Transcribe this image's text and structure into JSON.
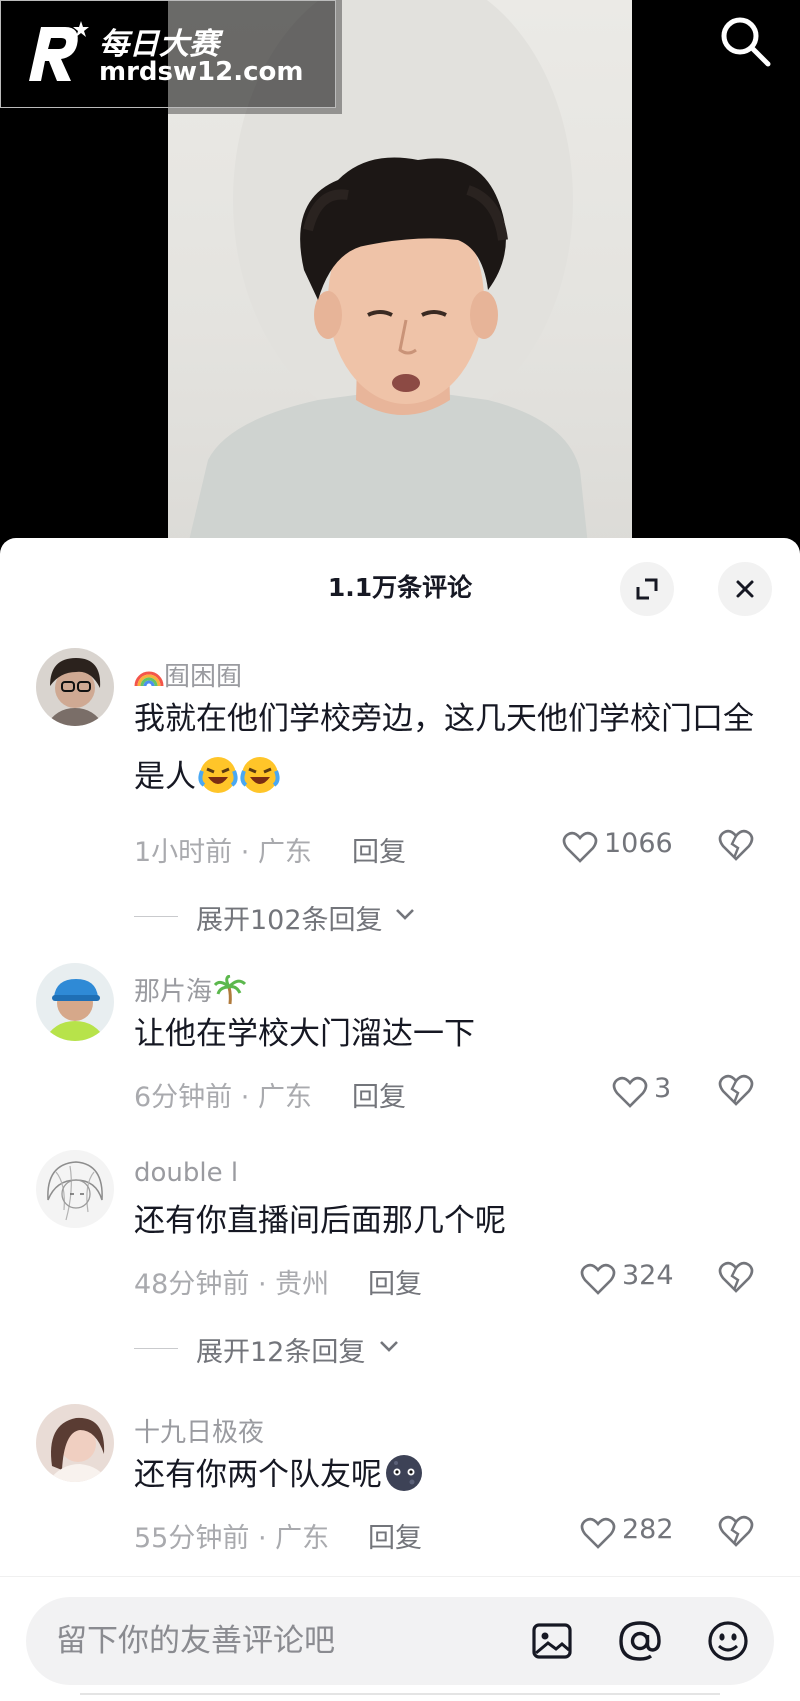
{
  "watermark": {
    "name": "每日大赛",
    "url": "mrdsw12.com"
  },
  "comments_panel": {
    "title": "1.1万条评论",
    "comments": [
      {
        "user": "囿困囿",
        "text": "我就在他们学校旁边，这几天他们学校门口全是人",
        "emoji": [
          "rofl-emoji",
          "rofl-emoji"
        ],
        "time": "1小时前",
        "location": "广东",
        "reply_label": "回复",
        "likes": "1066",
        "expand_replies": "展开102条回复"
      },
      {
        "user": "那片海",
        "text": "让他在学校大门溜达一下",
        "time": "6分钟前",
        "location": "广东",
        "reply_label": "回复",
        "likes": "3"
      },
      {
        "user": "double l",
        "text": "还有你直播间后面那几个呢",
        "time": "48分钟前",
        "location": "贵州",
        "reply_label": "回复",
        "likes": "324",
        "expand_replies": "展开12条回复"
      },
      {
        "user": "十九日极夜",
        "text": "还有你两个队友呢",
        "emoji": [
          "dark-face-emoji"
        ],
        "time": "55分钟前",
        "location": "广东",
        "reply_label": "回复",
        "likes": "282"
      }
    ]
  },
  "input": {
    "placeholder": "留下你的友善评论吧"
  },
  "icons": [
    "search-icon",
    "expand-icon",
    "close-icon",
    "heart-icon",
    "broken-heart-icon",
    "chevron-down-icon",
    "image-icon",
    "at-icon",
    "smiley-icon"
  ],
  "colors": {
    "text_primary": "#161823",
    "text_secondary": "#a9aaae",
    "sheet_bg": "#ffffff"
  }
}
